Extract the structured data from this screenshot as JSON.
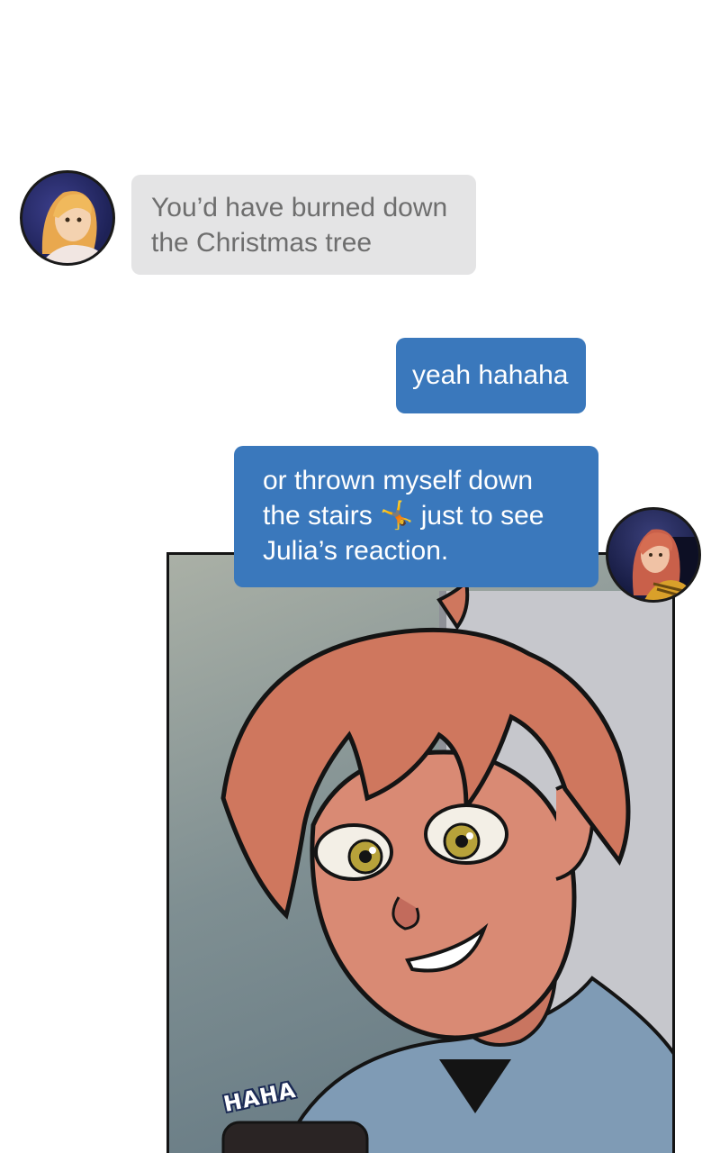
{
  "messages": [
    {
      "sender": "other",
      "lines": [
        "You’d have burned down",
        "the Christmas tree"
      ]
    },
    {
      "sender": "self",
      "lines": [
        "yeah hahaha"
      ]
    },
    {
      "sender": "self",
      "lines": [
        "or thrown myself down",
        "the stairs 🤸 just to see",
        "Julia’s reaction."
      ]
    }
  ],
  "panel": {
    "sfx_text": "HAHA"
  },
  "colors": {
    "received_bubble": "#e4e4e5",
    "received_text": "#6e6e6e",
    "sent_bubble": "#3a78bc",
    "sent_text": "#ffffff"
  }
}
